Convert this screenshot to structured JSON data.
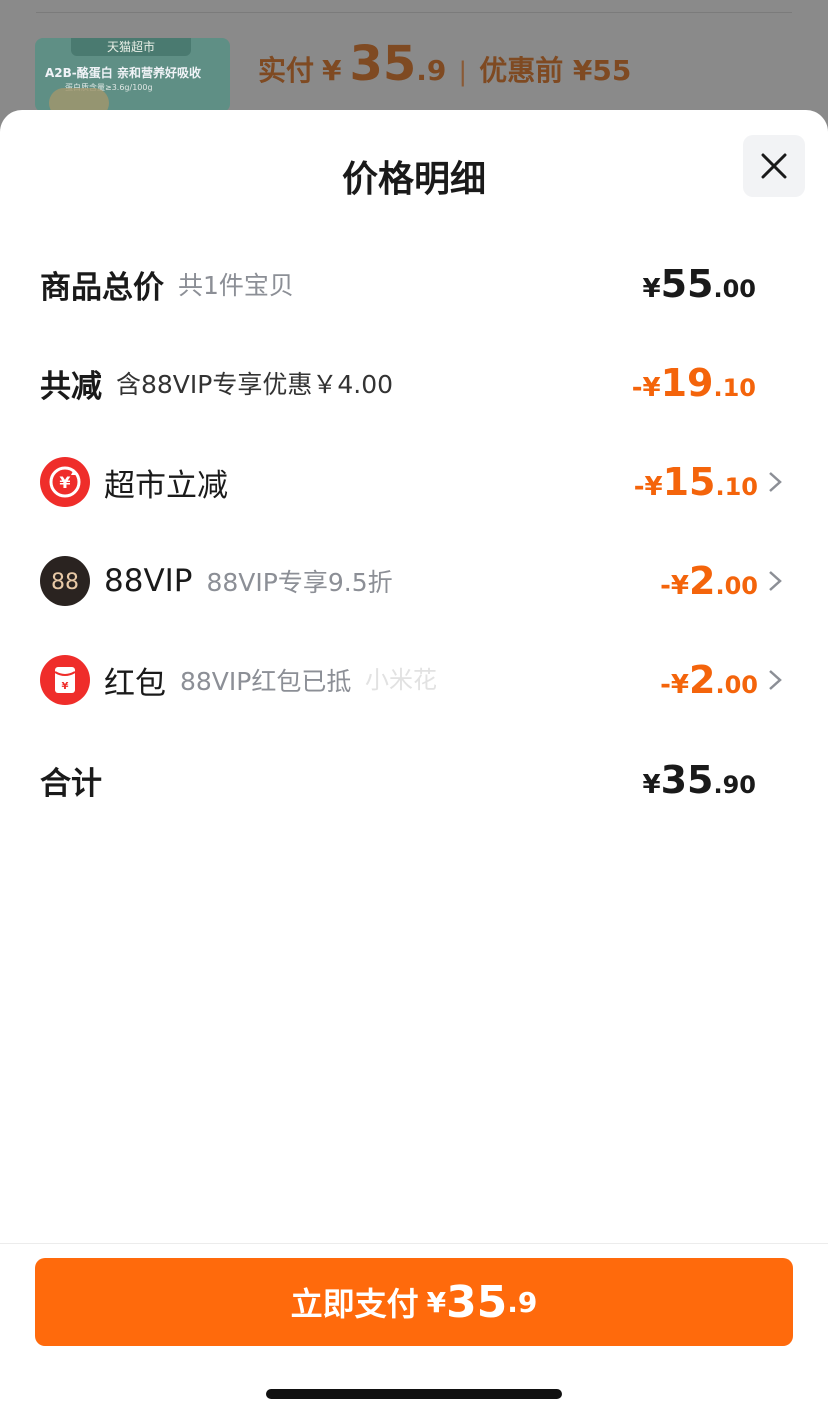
{
  "background": {
    "thumb_tag": "天猫超市",
    "thumb_title": "A2B-酪蛋白 亲和营养好吸收",
    "thumb_sub": "蛋白质含量≥3.6g/100g",
    "paid_label": "实付",
    "paid_yen": "¥",
    "paid_int": "35",
    "paid_dec": ".9",
    "separator": "|",
    "before_label": "优惠前 ¥55"
  },
  "sheet": {
    "title": "价格明细",
    "close_icon": "close-icon"
  },
  "rows": {
    "total": {
      "label": "商品总价",
      "sub": "共1件宝贝",
      "yen": "¥",
      "int": "55",
      "dec": ".00"
    },
    "discount": {
      "label": "共减",
      "sub": "含88VIP专享优惠￥4.00",
      "yen": "-¥",
      "int": "19",
      "dec": ".10"
    },
    "market": {
      "icon": "yuan-refresh-icon",
      "label": "超市立减",
      "yen": "-¥",
      "int": "15",
      "dec": ".10"
    },
    "vip": {
      "icon": "88-badge-icon",
      "icon_text": "88",
      "label": "88VIP",
      "sub": "88VIP专享9.5折",
      "yen": "-¥",
      "int": "2",
      "dec": ".00"
    },
    "redpacket": {
      "icon": "red-packet-icon",
      "label": "红包",
      "sub": "88VIP红包已抵",
      "yen": "-¥",
      "int": "2",
      "dec": ".00"
    },
    "sum": {
      "label": "合计",
      "yen": "¥",
      "int": "35",
      "dec": ".90"
    }
  },
  "watermark": "小米花",
  "pay_button": {
    "label": "立即支付",
    "yen": "¥",
    "int": "35",
    "dec": ".9"
  },
  "colors": {
    "accent": "#ff6a0c",
    "discount": "#f4640b",
    "text": "#1a1a1a",
    "muted": "#8c8f96"
  }
}
